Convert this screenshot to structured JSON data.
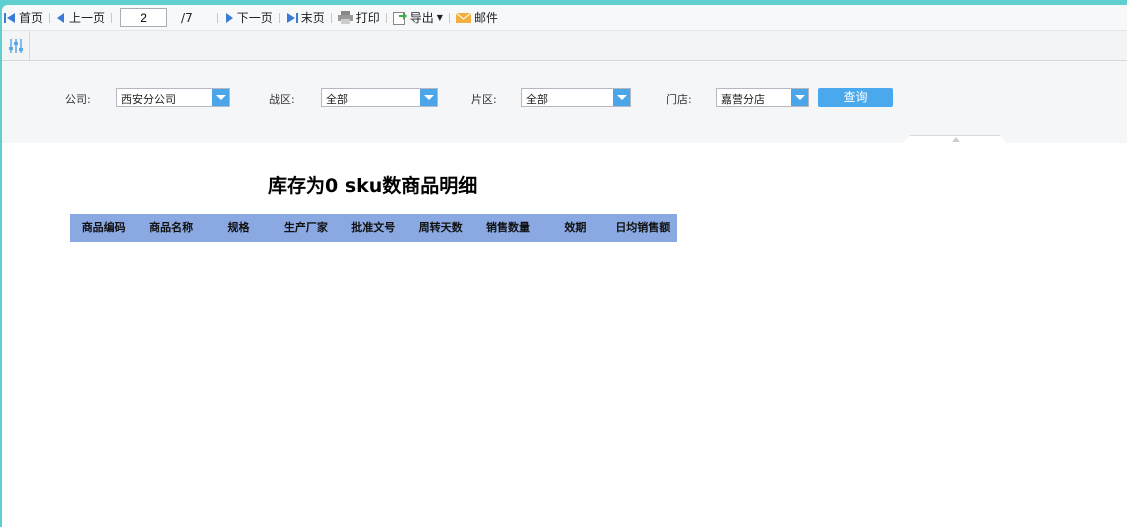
{
  "toolbar": {
    "first": "首页",
    "prev": "上一页",
    "page": "2",
    "total": "/7",
    "next": "下一页",
    "last": "末页",
    "print": "打印",
    "export": "导出",
    "mail": "邮件"
  },
  "filters": {
    "company": {
      "label": "公司:",
      "value": "西安分公司"
    },
    "war_zone": {
      "label": "战区:",
      "value": "全部"
    },
    "area": {
      "label": "片区:",
      "value": "全部"
    },
    "store": {
      "label": "门店:",
      "value": "嘉营分店"
    },
    "query": "查询"
  },
  "report": {
    "title": "库存为0 sku数商品明细",
    "columns": [
      "商品编码",
      "商品名称",
      "规格",
      "生产厂家",
      "批准文号",
      "周转天数",
      "销售数量",
      "效期",
      "日均销售额"
    ]
  }
}
